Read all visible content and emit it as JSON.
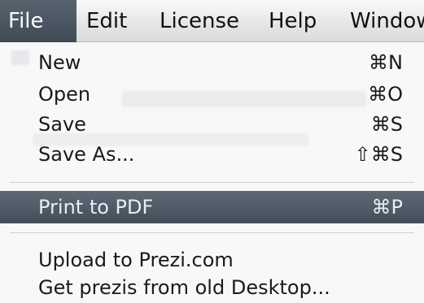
{
  "menubar": {
    "items": [
      {
        "label": "File",
        "active": true
      },
      {
        "label": "Edit"
      },
      {
        "label": "License"
      },
      {
        "label": "Help"
      },
      {
        "label": "Window"
      }
    ]
  },
  "file_menu": {
    "items": [
      {
        "label": "New",
        "shortcut": "⌘N"
      },
      {
        "label": "Open",
        "shortcut": "⌘O"
      },
      {
        "label": "Save",
        "shortcut": "⌘S"
      },
      {
        "label": "Save As...",
        "shortcut": "⇧⌘S"
      },
      {
        "label": "Print to PDF",
        "shortcut": "⌘P",
        "highlighted": true
      },
      {
        "label": "Upload to Prezi.com"
      },
      {
        "label": "Get prezis from old Desktop..."
      }
    ]
  },
  "colors": {
    "highlight": "#4e5a65",
    "menu_background": "#f8f8f8"
  }
}
